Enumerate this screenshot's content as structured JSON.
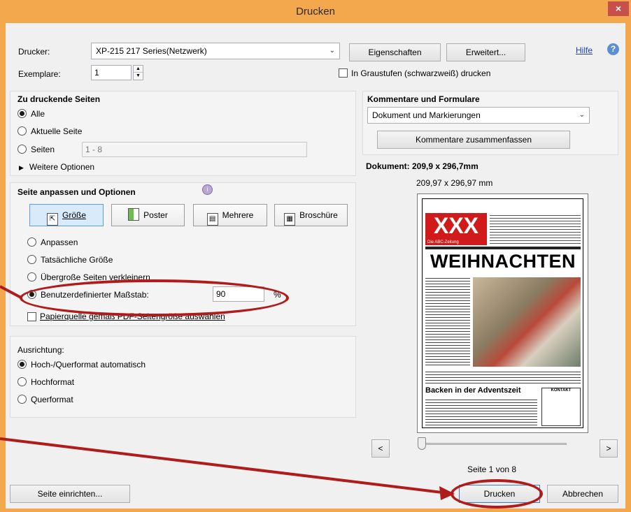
{
  "window": {
    "title": "Drucken",
    "close_glyph": "×"
  },
  "printer": {
    "label": "Drucker:",
    "value": "XP-215 217 Series(Netzwerk)",
    "properties_btn": "Eigenschaften",
    "advanced_btn": "Erweitert...",
    "help_link": "Hilfe"
  },
  "copies": {
    "label": "Exemplare:",
    "value": "1",
    "grayscale_label": "In Graustufen (schwarzweiß) drucken",
    "grayscale_checked": false
  },
  "pages_section": {
    "heading": "Zu druckende Seiten",
    "options": [
      {
        "label": "Alle",
        "checked": true
      },
      {
        "label": "Aktuelle Seite",
        "checked": false
      },
      {
        "label": "Seiten",
        "checked": false
      }
    ],
    "range_value": "1 - 8",
    "more_options": "Weitere Optionen"
  },
  "fit_section": {
    "heading": "Seite anpassen und Optionen",
    "buttons": [
      {
        "label": "Größe",
        "active": true
      },
      {
        "label": "Poster",
        "active": false
      },
      {
        "label": "Mehrere",
        "active": false
      },
      {
        "label": "Broschüre",
        "active": false
      }
    ],
    "options": [
      {
        "label": "Anpassen",
        "checked": false
      },
      {
        "label": "Tatsächliche Größe",
        "checked": false
      },
      {
        "label": "Übergroße Seiten verkleinern",
        "checked": false
      },
      {
        "label": "Benutzerdefinierter Maßstab:",
        "checked": true
      }
    ],
    "scale_value": "90",
    "scale_unit": "%",
    "paper_source_label": "Papierquelle gemäß PDF-Seitengröße auswählen",
    "paper_source_checked": false
  },
  "orientation": {
    "heading": "Ausrichtung:",
    "options": [
      {
        "label": "Hoch-/Querformat automatisch",
        "checked": true
      },
      {
        "label": "Hochformat",
        "checked": false
      },
      {
        "label": "Querformat",
        "checked": false
      }
    ]
  },
  "comments": {
    "heading": "Kommentare und Formulare",
    "value": "Dokument und Markierungen",
    "summarize_btn": "Kommentare zusammenfassen"
  },
  "preview": {
    "doc_size": "Dokument: 209,9 x 296,7mm",
    "page_size": "209,97 x 296,97 mm",
    "page_counter": "Seite 1 von 8",
    "prev_btn": "<",
    "next_btn": ">",
    "newspaper": {
      "logo": "XXX",
      "subtitle": "Die ABC-Zeitung",
      "headline": "WEIHNACHTEN",
      "section_headline": "Backen in der Adventszeit",
      "box_title": "KONTAKT"
    }
  },
  "footer": {
    "page_setup_btn": "Seite einrichten...",
    "print_btn": "Drucken",
    "cancel_btn": "Abbrechen"
  },
  "colors": {
    "title_bar": "#f3a84d",
    "close_button": "#c7504a",
    "annotation": "#b01c1c",
    "link": "#1a3fc0"
  }
}
